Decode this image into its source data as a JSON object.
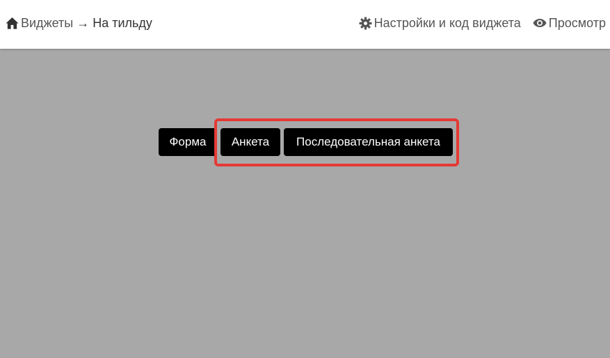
{
  "header": {
    "breadcrumb": {
      "home_icon": "home-icon",
      "root_label": "Виджеты",
      "separator": "→",
      "current_label": "На тильду"
    },
    "nav": {
      "settings": {
        "icon": "gear-icon",
        "label": "Настройки и код виджета"
      },
      "preview": {
        "icon": "eye-icon",
        "label": "Просмотр"
      }
    }
  },
  "main": {
    "tabs": [
      {
        "label": "Форма"
      },
      {
        "label": "Анкета"
      },
      {
        "label": "Последовательная анкета"
      }
    ],
    "highlight_color": "#e53935",
    "background_color": "#a8a8a8"
  }
}
